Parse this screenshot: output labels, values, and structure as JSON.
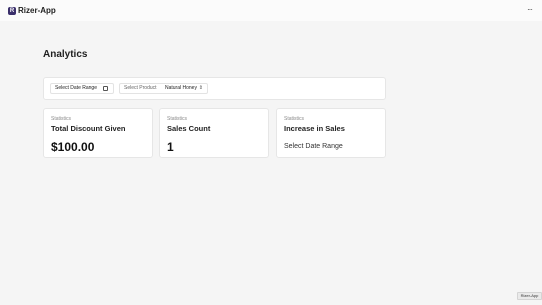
{
  "app": {
    "name": "Rizer-App",
    "logo_letter": "R"
  },
  "header": {
    "menu_icon": "more-horizontal-icon",
    "menu_glyph": "···"
  },
  "page": {
    "title": "Analytics"
  },
  "filters": {
    "date_range_label": "Select Date Range",
    "date_icon": "calendar-icon",
    "product_label": "Select Product",
    "product_value": "Natural Honey",
    "product_icon": "chevron-up-down-icon",
    "product_glyph": "⇕"
  },
  "cards": [
    {
      "eyebrow": "Statistics",
      "heading": "Total Discount Given",
      "value": "$100.00"
    },
    {
      "eyebrow": "Statistics",
      "heading": "Sales Count",
      "value": "1"
    },
    {
      "eyebrow": "Statistics",
      "heading": "Increase in Sales",
      "value": "Select Date Range"
    }
  ],
  "footer_badge": {
    "text": "Rizer-App"
  }
}
